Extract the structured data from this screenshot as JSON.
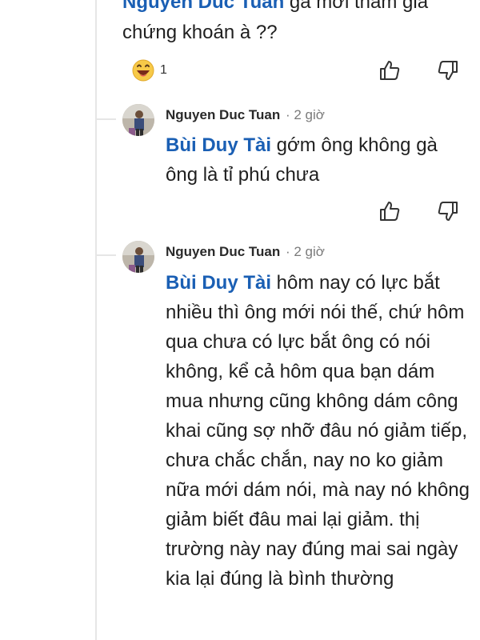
{
  "top_comment": {
    "mention": "Nguyen Duc Tuan",
    "text": " gà mới tham gia chứng khoán à ??",
    "reaction_count": "1",
    "reaction_icon": "laughing-face-icon"
  },
  "replies": [
    {
      "author": "Nguyen Duc Tuan",
      "time": "· 2 giờ",
      "mention": "Bùi Duy Tài",
      "text": " gớm ông không gà ông là tỉ phú chưa"
    },
    {
      "author": "Nguyen Duc Tuan",
      "time": "· 2 giờ",
      "mention": "Bùi Duy Tài",
      "text": " hôm nay có lực bắt nhiều thì ông mới nói thế, chứ hôm qua chưa có lực bắt ông có nói không, kể cả hôm qua bạn dám mua nhưng cũng không dám công khai cũng sợ nhỡ đâu nó giảm tiếp, chưa chắc chắn, nay no ko giảm nữa mới dám nói, mà nay nó không giảm biết đâu mai lại giảm. thị trường này nay đúng mai sai ngày kia lại đúng là bình thường"
    }
  ],
  "icons": {
    "like": "thumbs-up-icon",
    "dislike": "thumbs-down-icon"
  },
  "colors": {
    "mention": "#1a5fb4",
    "thread_line": "#e6e6e6"
  }
}
